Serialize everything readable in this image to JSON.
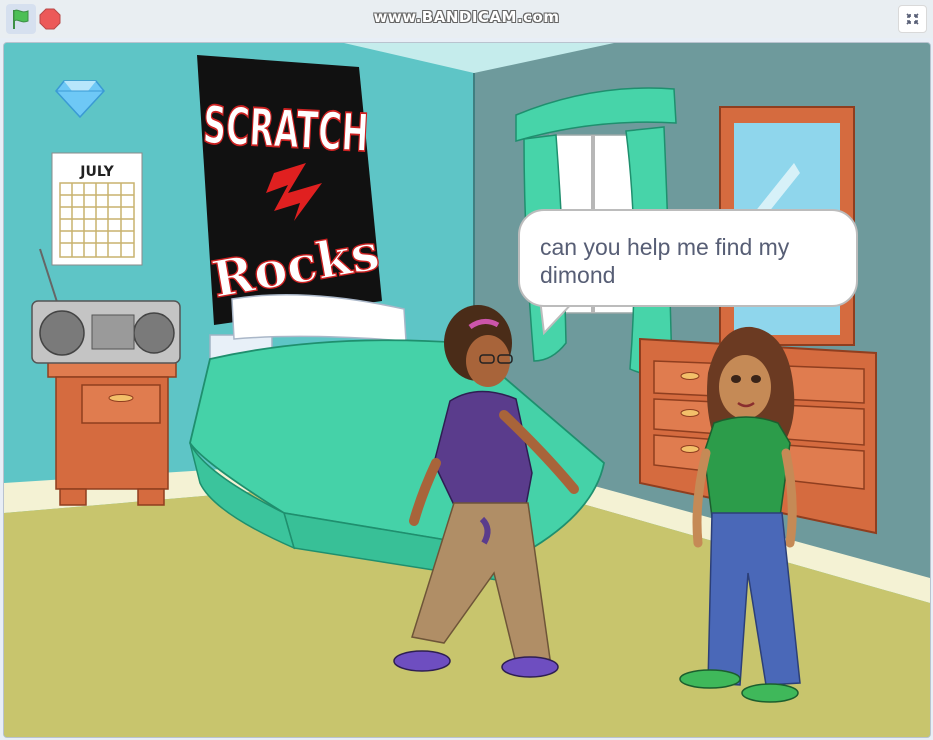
{
  "toolbar": {
    "watermark": "www.BANDICAM.com",
    "icons": {
      "green_flag": "green-flag-icon",
      "stop": "stop-icon",
      "fullscreen": "exit-fullscreen-icon"
    }
  },
  "stage": {
    "calendar_month": "JULY",
    "poster_line1": "SCRATCH",
    "poster_line2": "Rocks",
    "speech_bubble": "can you help me find my dimond"
  },
  "colors": {
    "flag_green": "#4cbf56",
    "stop_red": "#ec5959",
    "wall_left": "#5ec5c6",
    "wall_right": "#6e9a9c",
    "floor": "#c8c56d",
    "bed": "#45d2a8",
    "dresser": "#d56b3f"
  }
}
